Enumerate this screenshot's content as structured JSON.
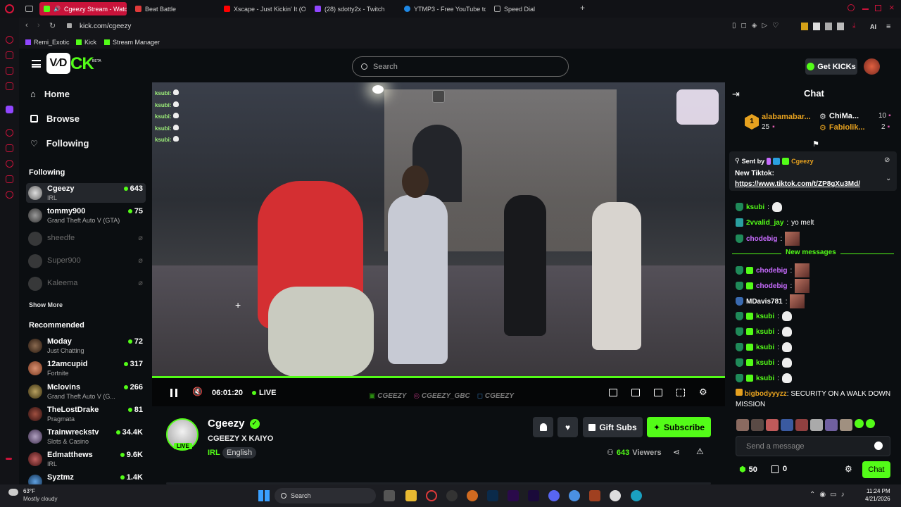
{
  "browser": {
    "tabs": [
      {
        "label": "Cgeezy Stream - Watc",
        "active": true
      },
      {
        "label": "Beat Battle"
      },
      {
        "label": "Xscape - Just Kickin' It (O"
      },
      {
        "label": "(28) sdotty2x - Twitch"
      },
      {
        "label": "YTMP3 - Free YouTube to"
      },
      {
        "label": "Speed Dial"
      }
    ],
    "url": "kick.com/cgeezy",
    "bookmarks": [
      "Remi_Exotic",
      "Kick",
      "Stream Manager"
    ],
    "ai_label": "AI"
  },
  "header": {
    "logo_box": "V⁄D",
    "logo_ck": "CK",
    "logo_beta": "BETA",
    "search_placeholder": "Search",
    "get_kicks": "Get KICKs"
  },
  "sidebar": {
    "nav": [
      {
        "label": "Home",
        "icon": "home-icon"
      },
      {
        "label": "Browse",
        "icon": "browse-icon"
      },
      {
        "label": "Following",
        "icon": "heart-icon"
      }
    ],
    "following_title": "Following",
    "following": [
      {
        "name": "Cgeezy",
        "category": "IRL",
        "viewers": "643",
        "live": true,
        "selected": true
      },
      {
        "name": "tommy900",
        "category": "Grand Theft Auto V (GTA)",
        "viewers": "75",
        "live": true
      },
      {
        "name": "sheedfe",
        "live": false
      },
      {
        "name": "Super900",
        "live": false
      },
      {
        "name": "Kaleema",
        "live": false
      }
    ],
    "show_more": "Show More",
    "recommended_title": "Recommended",
    "recommended": [
      {
        "name": "Moday",
        "category": "Just Chatting",
        "viewers": "72"
      },
      {
        "name": "12amcupid",
        "category": "Fortnite",
        "viewers": "317"
      },
      {
        "name": "Mclovins",
        "category": "Grand Theft Auto V (G...",
        "viewers": "266"
      },
      {
        "name": "TheLostDrake",
        "category": "Pragmata",
        "viewers": "81"
      },
      {
        "name": "Trainwreckstv",
        "category": "Slots & Casino",
        "viewers": "34.4K"
      },
      {
        "name": "Edmatthews",
        "category": "IRL",
        "viewers": "9.6K"
      },
      {
        "name": "Syztmz",
        "category": "",
        "viewers": "1.4K"
      }
    ]
  },
  "video": {
    "overlay_chat": [
      "ksubi:",
      "ksubi:",
      "ksubi:",
      "ksubi:",
      "ksubi:"
    ],
    "time": "06:01:20",
    "live_label": "LIVE",
    "watermark": [
      "CGEEZY",
      "CGEEZY_GBC",
      "CGEEZY"
    ]
  },
  "channel": {
    "name": "Cgeezy",
    "title": "CGEEZY X KAIYO",
    "category": "IRL",
    "language": "English",
    "live_badge": "LIVE",
    "viewers": "643",
    "viewers_label": "Viewers",
    "gift_subs": "Gift Subs",
    "subscribe": "Subscribe"
  },
  "chat": {
    "title": "Chat",
    "leaderboard": [
      {
        "rank": "1",
        "name": "alabamabar...",
        "count": "25"
      },
      {
        "name": "ChiMa...",
        "count": "10"
      },
      {
        "name": "Fabiolik...",
        "count": "2"
      }
    ],
    "pinned": {
      "sent_by_label": "Sent by",
      "sender": "Cgeezy",
      "text": "New Tiktok:",
      "link": "https://www.tiktok.com/t/ZP8gXu3Md/"
    },
    "messages_before": [
      {
        "user": "ksubi",
        "color": "#53fc18",
        "text": ""
      },
      {
        "user": "2vvalid_jay",
        "color": "#53fc18",
        "text": "yo melt"
      },
      {
        "user": "chodebig",
        "color": "#c86cff",
        "text": ""
      }
    ],
    "new_messages_label": "New messages",
    "messages_after": [
      {
        "user": "chodebig",
        "color": "#c86cff"
      },
      {
        "user": "chodebig",
        "color": "#c86cff"
      },
      {
        "user": "MDavis781",
        "color": "#ffffff"
      },
      {
        "user": "ksubi",
        "color": "#53fc18"
      },
      {
        "user": "ksubi",
        "color": "#53fc18"
      },
      {
        "user": "ksubi",
        "color": "#53fc18"
      },
      {
        "user": "ksubi",
        "color": "#53fc18"
      },
      {
        "user": "ksubi",
        "color": "#53fc18"
      }
    ],
    "last_user": "bigbodyyyzz",
    "last_text": "SECURITY ON A WALK DOWN MISSION",
    "input_placeholder": "Send a message",
    "kicks_count": "50",
    "gift_count": "0",
    "chat_button": "Chat"
  },
  "taskbar": {
    "weather_temp": "63°F",
    "weather_desc": "Mostly cloudy",
    "search_label": "Search",
    "time": "11:24 PM",
    "date": "4/21/2026"
  },
  "colors": {
    "accent": "#53fc18",
    "opera_red": "#c9133a"
  }
}
